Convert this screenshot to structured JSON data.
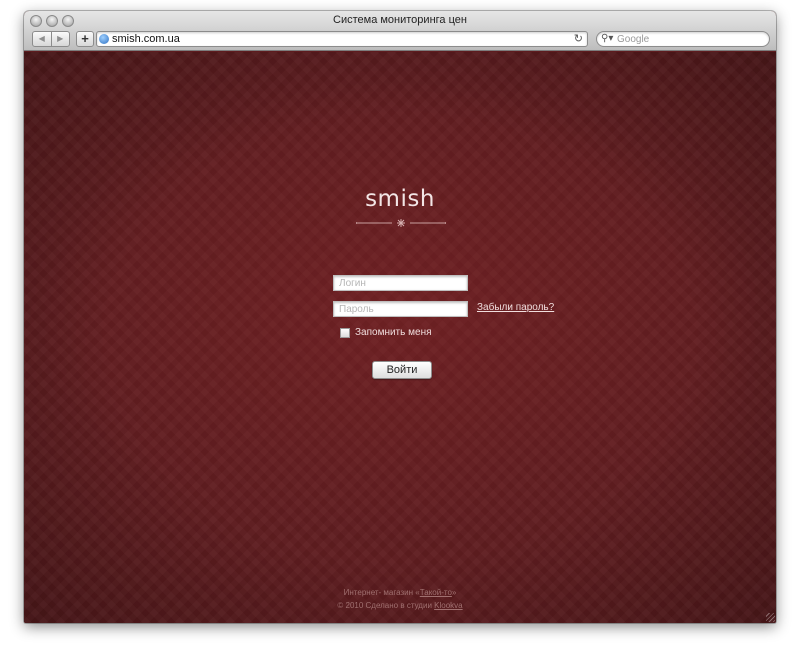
{
  "window": {
    "title": "Система мониторинга цен",
    "url": "smish.com.ua",
    "search_placeholder": "Google"
  },
  "colors": {
    "background": "#5f1d20",
    "text_light": "#f1dede",
    "footer_text": "#a07070"
  },
  "icons": {
    "back": "back-arrow-icon",
    "forward": "forward-arrow-icon",
    "add": "plus-icon",
    "site": "globe-icon",
    "reload": "reload-icon",
    "search": "magnifier-icon"
  },
  "page": {
    "logo": "smish",
    "login_placeholder": "Логин",
    "password_placeholder": "Пароль",
    "forgot_password": "Забыли пароль?",
    "remember_me": "Запомнить меня",
    "remember_checked": false,
    "submit": "Войти"
  },
  "footer": {
    "line1_prefix": "Интернет- магазин «",
    "line1_link": "Такой-то",
    "line1_suffix": "»",
    "line2_prefix": "© 2010 Сделано в студии ",
    "line2_link": "Klookva"
  }
}
